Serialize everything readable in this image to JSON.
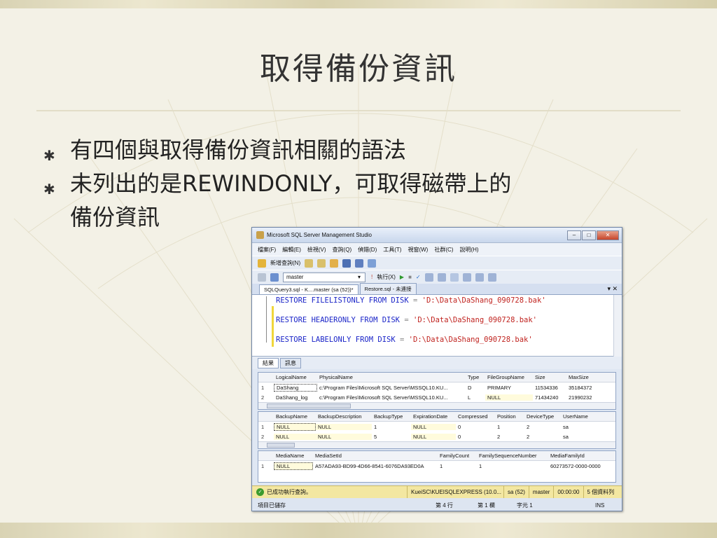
{
  "slide": {
    "title": "取得備份資訊",
    "bullets": [
      "有四個與取得備份資訊相關的語法",
      "未列出的是REWINDONLY，可取得磁帶上的",
      "備份資訊"
    ]
  },
  "window": {
    "title": "Microsoft SQL Server Management Studio",
    "menu": [
      "檔案(F)",
      "編輯(E)",
      "檢視(V)",
      "查詢(Q)",
      "偵錯(D)",
      "工具(T)",
      "視窗(W)",
      "社群(C)",
      "說明(H)"
    ],
    "toolbar1": {
      "new_query": "新增查詢(N)"
    },
    "toolbar2": {
      "database": "master",
      "execute": "執行(X)"
    },
    "tabs": [
      "SQLQuery3.sql - K....master (sa (52))*",
      "Restore.sql - 未連接"
    ],
    "editor_lines": [
      {
        "kw": "RESTORE FILELISTONLY FROM DISK",
        "op": "=",
        "str": "'D:\\Data\\DaShang_090728.bak'"
      },
      {
        "kw": "RESTORE HEADERONLY FROM DISK",
        "op": "=",
        "str": "'D:\\Data\\DaShang_090728.bak'"
      },
      {
        "kw": "RESTORE LABELONLY FROM DISK",
        "op": "=",
        "str": "'D:\\Data\\DaShang_090728.bak'"
      }
    ],
    "result_tabs": [
      "結果",
      "訊息"
    ],
    "grid1": {
      "headers": [
        "LogicalName",
        "PhysicalName",
        "Type",
        "FileGroupName",
        "Size",
        "MaxSize"
      ],
      "rows": [
        [
          "1",
          "DaShang",
          "c:\\Program Files\\Microsoft SQL Server\\MSSQL10.KU...",
          "D",
          "PRIMARY",
          "11534336",
          "35184372"
        ],
        [
          "2",
          "DaShang_log",
          "c:\\Program Files\\Microsoft SQL Server\\MSSQL10.KU...",
          "L",
          "NULL",
          "71434240",
          "21990232"
        ]
      ]
    },
    "grid2": {
      "headers": [
        "BackupName",
        "BackupDescription",
        "BackupType",
        "ExpirationDate",
        "Compressed",
        "Position",
        "DeviceType",
        "UserName"
      ],
      "rows": [
        [
          "1",
          "NULL",
          "NULL",
          "1",
          "NULL",
          "0",
          "1",
          "2",
          "sa"
        ],
        [
          "2",
          "NULL",
          "NULL",
          "5",
          "NULL",
          "0",
          "2",
          "2",
          "sa"
        ]
      ]
    },
    "grid3": {
      "headers": [
        "MediaName",
        "MediaSetId",
        "FamilyCount",
        "FamilySequenceNumber",
        "MediaFamilyId"
      ],
      "rows": [
        [
          "1",
          "NULL",
          "A57ADA93-BD99-4D66-8541-6076DA93ED0A",
          "1",
          "1",
          "60273572-0000-0000"
        ]
      ]
    },
    "status": {
      "message": "已成功執行查詢。",
      "server": "KueiSC\\KUEISQLEXPRESS (10.0...",
      "user": "sa (52)",
      "db": "master",
      "time": "00:00:00",
      "rows": "5 個資料列"
    },
    "statusbar": {
      "left": "項目已儲存",
      "line": "第 4 行",
      "col": "第 1 欄",
      "ch": "字元 1",
      "mode": "INS"
    }
  }
}
